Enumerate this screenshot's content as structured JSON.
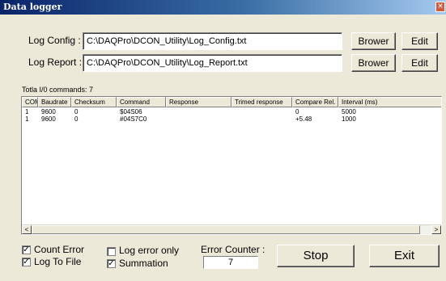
{
  "window": {
    "title": "Data logger",
    "close_glyph": "×"
  },
  "config": {
    "log_config_label": "Log Config :",
    "log_config_value": "C:\\DAQPro\\DCON_Utility\\Log_Config.txt",
    "log_report_label": "Log Report :",
    "log_report_value": "C:\\DAQPro\\DCON_Utility\\Log_Report.txt",
    "browse_label": "Brower",
    "edit_label": "Edit"
  },
  "commands": {
    "total_label": "Totla I/0 commands: 7",
    "columns": [
      "COM",
      "Baudrate",
      "Checksum",
      "Command",
      "Response",
      "Trimed response",
      "Compare Rel.",
      "Interval (ms)"
    ],
    "rows": [
      [
        "1",
        "9600",
        "0",
        "$04S06",
        "",
        "",
        "0",
        "5000"
      ],
      [
        "1",
        "9600",
        "0",
        "#04S7C0",
        "",
        "",
        "+5.48",
        "1000"
      ]
    ]
  },
  "scrollbar": {
    "left_glyph": "<",
    "right_glyph": ">"
  },
  "options": {
    "count_error_label": "Count Error",
    "count_error_checked": true,
    "log_to_file_label": "Log To File",
    "log_to_file_checked": true,
    "log_error_only_label": "Log error only",
    "log_error_only_checked": false,
    "summation_label": "Summation",
    "summation_checked": true,
    "check_glyph": "✓"
  },
  "error_counter": {
    "label": "Error Counter :",
    "value": "7"
  },
  "actions": {
    "stop_label": "Stop",
    "exit_label": "Exit"
  },
  "colors": {
    "titlebar_start": "#0a246a",
    "titlebar_end": "#a6caf0",
    "face": "#ece9d8"
  }
}
